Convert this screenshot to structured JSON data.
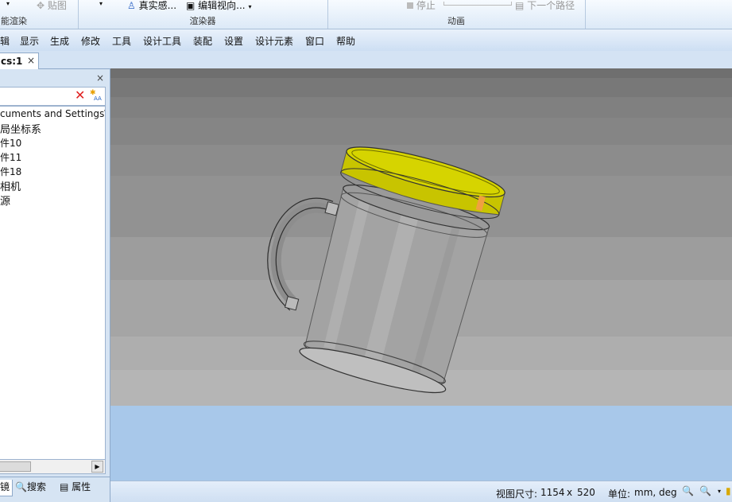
{
  "ribbon": {
    "smart_render_label": "智能渲染",
    "paste_label": "贴图",
    "realistic_label": "真实感...",
    "edit_view_label": "编辑视向...",
    "renderer_group": "渲染器",
    "stop_label": "停止",
    "next_path_label": "下一个路径",
    "animation_group": "动画"
  },
  "menu": [
    "辑",
    "显示",
    "生成",
    "修改",
    "工具",
    "设计工具",
    "装配",
    "设置",
    "设计元素",
    "窗口",
    "帮助"
  ],
  "tab": {
    "title": "cs:1",
    "close": "×"
  },
  "panel": {
    "close": "×",
    "tree_items": [
      "cuments and Settings\\A",
      "局坐标系",
      "件10",
      "件11",
      "件18",
      "相机",
      "源"
    ]
  },
  "bottom_tabs": [
    "镜",
    "搜索",
    "属性"
  ],
  "status": {
    "view_size_label": "视图尺寸:",
    "view_w": "1154",
    "x": "x",
    "view_h": "520",
    "unit_label": "单位:",
    "unit_value": "mm, deg"
  },
  "colors": {
    "lid": "#c8c400",
    "accent_blue": "#a8c8ea"
  },
  "icons": {
    "delete": "red-x-icon",
    "search_options": "star-filter-icon",
    "zoom": "magnifier-icon"
  }
}
